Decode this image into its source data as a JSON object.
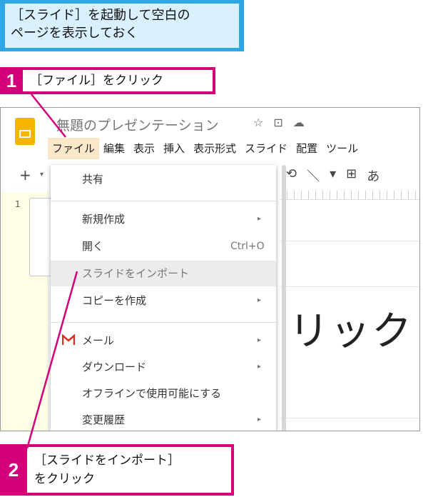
{
  "callout": {
    "text": "［スライド］を起動して空白の\nページを表示しておく"
  },
  "steps": [
    {
      "number": "1",
      "text": "［ファイル］をクリック"
    },
    {
      "number": "2",
      "text": "［スライドをインポート］\nをクリック"
    }
  ],
  "app": {
    "doc_title": "無題のプレゼンテーション",
    "title_icons": [
      "☆",
      "⊡",
      "☁"
    ],
    "menubar": [
      "ファイル",
      "編集",
      "表示",
      "挿入",
      "表示形式",
      "スライド",
      "配置",
      "ツール"
    ],
    "slide_number": "1",
    "canvas_text": "リック",
    "toolbar_right": [
      "⟲",
      "＼",
      "▾",
      "⊞",
      "あ"
    ]
  },
  "file_menu": {
    "items": [
      {
        "label": "共有"
      },
      {
        "label": "新規作成",
        "arrow": "▸"
      },
      {
        "label": "開く",
        "shortcut": "Ctrl+O"
      },
      {
        "label": "スライドをインポート"
      },
      {
        "label": "コピーを作成",
        "arrow": "▸"
      },
      {
        "label": "メール",
        "arrow": "▸",
        "icon": "gmail-icon"
      },
      {
        "label": "ダウンロード",
        "arrow": "▸"
      },
      {
        "label": "オフラインで使用可能にする"
      },
      {
        "label": "変更履歴",
        "arrow": "▸"
      }
    ]
  },
  "colors": {
    "callout_border": "#2fa6e6",
    "callout_fill": "#d9f0ff",
    "step_accent": "#d4007a",
    "logo": "#f4b400",
    "gmail": "#d93025"
  }
}
